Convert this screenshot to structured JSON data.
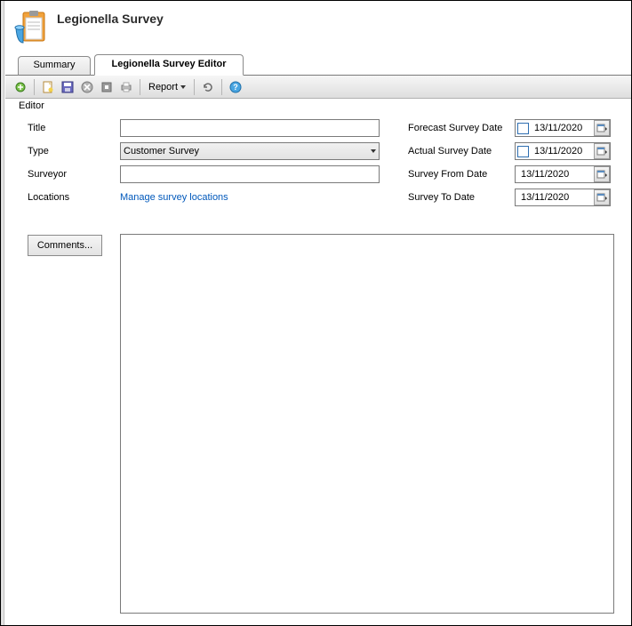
{
  "header": {
    "title": "Legionella Survey"
  },
  "tabs": {
    "summary": "Summary",
    "editor": "Legionella Survey Editor"
  },
  "toolbar": {
    "report_label": "Report"
  },
  "group": {
    "label": "Editor"
  },
  "form": {
    "title_label": "Title",
    "title_value": "",
    "type_label": "Type",
    "type_value": "Customer Survey",
    "surveyor_label": "Surveyor",
    "surveyor_value": "",
    "locations_label": "Locations",
    "locations_link": "Manage survey locations",
    "forecast_label": "Forecast Survey Date",
    "forecast_value": "13/11/2020",
    "actual_label": "Actual Survey Date",
    "actual_value": "13/11/2020",
    "from_label": "Survey From Date",
    "from_value": "13/11/2020",
    "to_label": "Survey To Date",
    "to_value": "13/11/2020"
  },
  "buttons": {
    "comments": "Comments..."
  }
}
